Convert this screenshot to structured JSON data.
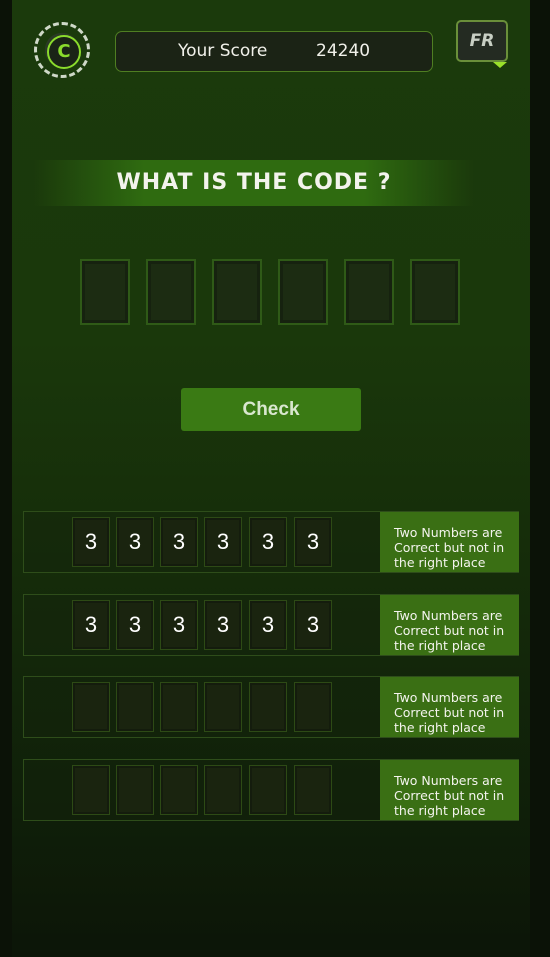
{
  "header": {
    "logo_icon": "refresh-arrow-icon",
    "logo_glyph": "C",
    "score_label": "Your Score",
    "score_value": "24240",
    "language": "FR"
  },
  "title": "WHAT IS THE CODE ?",
  "code_input": [
    "",
    "",
    "",
    "",
    "",
    ""
  ],
  "check_label": "Check",
  "history": [
    {
      "digits": [
        "3",
        "3",
        "3",
        "3",
        "3",
        "3"
      ],
      "feedback": "Two Numbers are Correct but not in the right place"
    },
    {
      "digits": [
        "3",
        "3",
        "3",
        "3",
        "3",
        "3"
      ],
      "feedback": "Two Numbers are Correct but not in the right place"
    },
    {
      "digits": [
        "",
        "",
        "",
        "",
        "",
        ""
      ],
      "feedback": "Two Numbers are Correct but not in the right place"
    },
    {
      "digits": [
        "",
        "",
        "",
        "",
        "",
        ""
      ],
      "feedback": "Two Numbers are Correct but not in the right place"
    }
  ],
  "colors": {
    "accent": "#3a7a14",
    "feedback_bg": "#3a6f14",
    "caret": "#9ae02a"
  }
}
